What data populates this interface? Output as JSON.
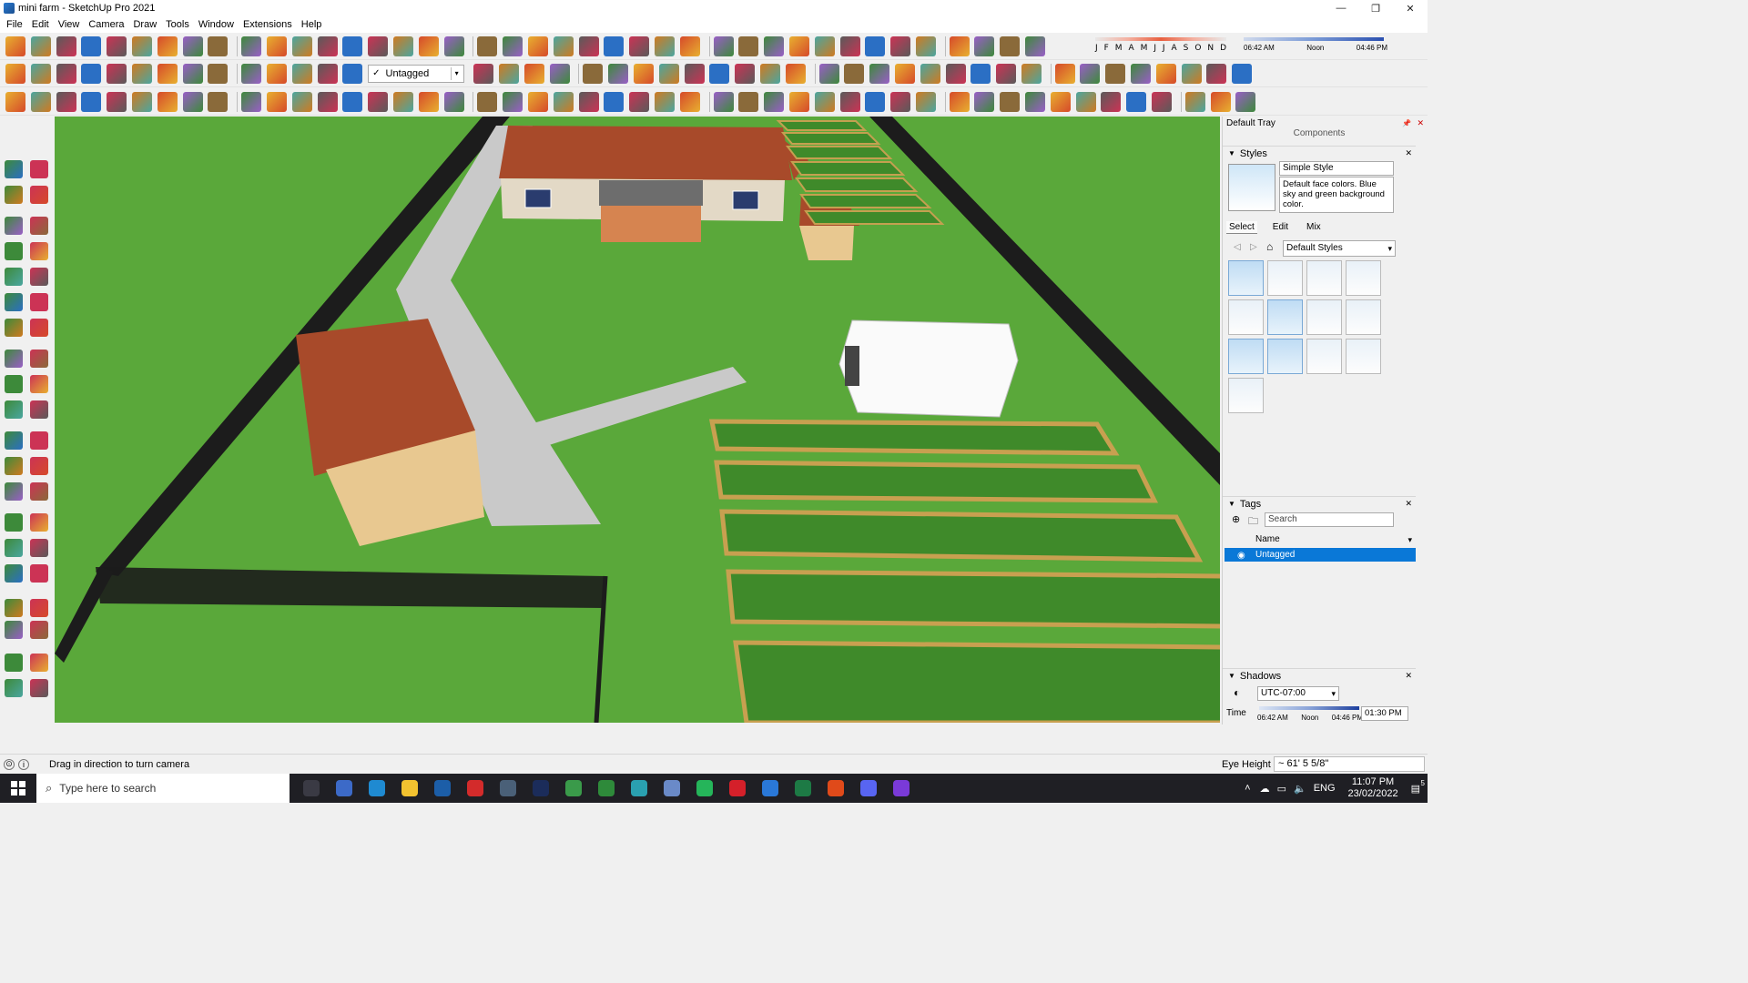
{
  "window": {
    "title": "mini farm - SketchUp Pro 2021",
    "controls": [
      "—",
      "❐",
      "✕"
    ]
  },
  "menu": [
    "File",
    "Edit",
    "View",
    "Camera",
    "Draw",
    "Tools",
    "Window",
    "Extensions",
    "Help"
  ],
  "toolbar": {
    "tag_select_value": "Untagged",
    "shadow_months": [
      "J",
      "F",
      "M",
      "A",
      "M",
      "J",
      "J",
      "A",
      "S",
      "O",
      "N",
      "D"
    ],
    "shadow_time_labels": [
      "06:42 AM",
      "Noon",
      "04:46 PM"
    ]
  },
  "tray": {
    "title": "Default Tray",
    "components_label": "Components",
    "styles": {
      "panel_title": "Styles",
      "style_name": "Simple Style",
      "style_description": "Default face colors. Blue sky and green background color.",
      "tabs": [
        "Select",
        "Edit",
        "Mix"
      ],
      "collection": "Default Styles"
    },
    "tags": {
      "panel_title": "Tags",
      "search_placeholder": "Search",
      "column_name": "Name",
      "rows": [
        "Untagged"
      ]
    },
    "shadows": {
      "panel_title": "Shadows",
      "timezone": "UTC-07:00",
      "time_label": "Time",
      "time_scale": [
        "06:42 AM",
        "Noon",
        "04:46 PM"
      ],
      "time_value": "01:30 PM"
    }
  },
  "status": {
    "message": "Drag in direction to turn camera",
    "eye_height_label": "Eye Height",
    "eye_height_value": "~ 61' 5 5/8\""
  },
  "taskbar": {
    "search_placeholder": "Type here to search",
    "language": "ENG",
    "time": "11:07 PM",
    "date": "23/02/2022",
    "notification_count": "5"
  },
  "colors": {
    "grass": "#5aa83a",
    "path": "#c9c9c9",
    "roof": "#a84a2a",
    "wall_tan": "#e8c890",
    "fence": "#1c1c1c",
    "accent_blue": "#0a78d7"
  }
}
